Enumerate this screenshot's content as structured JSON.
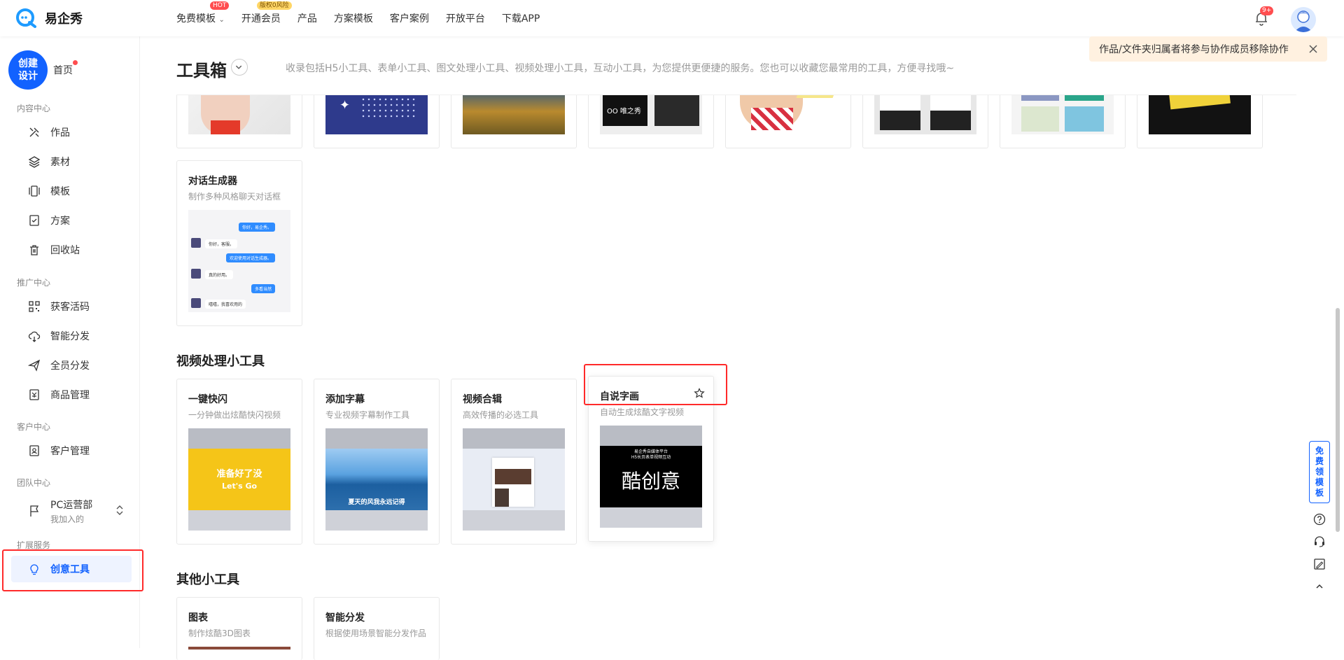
{
  "app": {
    "name": "易企秀"
  },
  "nav": {
    "items": [
      {
        "label": "免费模板",
        "badge": "HOT"
      },
      {
        "label": "开通会员",
        "badge": "版权0风险"
      },
      {
        "label": "产品"
      },
      {
        "label": "方案模板"
      },
      {
        "label": "客户案例"
      },
      {
        "label": "开放平台"
      },
      {
        "label": "下载APP"
      }
    ],
    "notification_count": "9+"
  },
  "sidebar": {
    "create_label_1": "创建",
    "create_label_2": "设计",
    "home": "首页",
    "groups": [
      "内容中心",
      "推广中心",
      "客户中心",
      "团队中心",
      "扩展服务"
    ],
    "items": [
      {
        "label": "作品",
        "icon": "brush-icon"
      },
      {
        "label": "素材",
        "icon": "layers-icon"
      },
      {
        "label": "模板",
        "icon": "template-icon"
      },
      {
        "label": "方案",
        "icon": "checklist-icon"
      },
      {
        "label": "回收站",
        "icon": "trash-icon"
      },
      {
        "label": "获客活码",
        "icon": "qrcode-icon"
      },
      {
        "label": "智能分发",
        "icon": "cloud-share-icon"
      },
      {
        "label": "全员分发",
        "icon": "send-icon"
      },
      {
        "label": "商品管理",
        "icon": "product-icon"
      },
      {
        "label": "客户管理",
        "icon": "contact-icon"
      }
    ],
    "team": {
      "label": "PC运营部",
      "sub": "我加入的"
    },
    "creative_tool": "创意工具"
  },
  "header": {
    "title": "工具箱",
    "description": "收录包括H5小工具、表单小工具、图文处理小工具、视频处理小工具，互动小工具，为您提供更便捷的服务。您也可以收藏您最常用的工具，方便寻找哦~"
  },
  "notice": {
    "text": "作品/文件夹归属者将参与协作成员移除协作"
  },
  "dialog_card": {
    "title": "对话生成器",
    "desc": "制作多种风格聊天对话框",
    "chat": [
      "你好，易企秀。",
      "你好，客服。",
      "欢迎使用对话生成器。",
      "真的好用。",
      "多看当然",
      "嘻嘻，我喜欢用的"
    ]
  },
  "video_section": {
    "title": "视频处理小工具",
    "cards": [
      {
        "title": "一键快闪",
        "desc": "一分钟做出炫酷快闪视频",
        "overlay_1": "准备好了没",
        "overlay_2": "Let's Go"
      },
      {
        "title": "添加字幕",
        "desc": "专业视频字幕制作工具",
        "overlay_1": "夏天的风我永远记得"
      },
      {
        "title": "视频合辑",
        "desc": "高效传播的必选工具"
      },
      {
        "title": "自说字画",
        "desc": "自动生成炫酷文字视频",
        "overlay_1": "酷创意",
        "overlay_small": "易企秀自媒体平台",
        "overlay_small_2": "H5长页表单视频互动"
      }
    ]
  },
  "other_section": {
    "title": "其他小工具",
    "cards": [
      {
        "title": "图表",
        "desc": "制作炫酷3D图表"
      },
      {
        "title": "智能分发",
        "desc": "根据使用场景智能分发作品"
      }
    ]
  },
  "float_bar": {
    "free_template": "免费领模板"
  },
  "colors": {
    "brand": "#1262ff",
    "highlight": "#ff2a2a"
  }
}
